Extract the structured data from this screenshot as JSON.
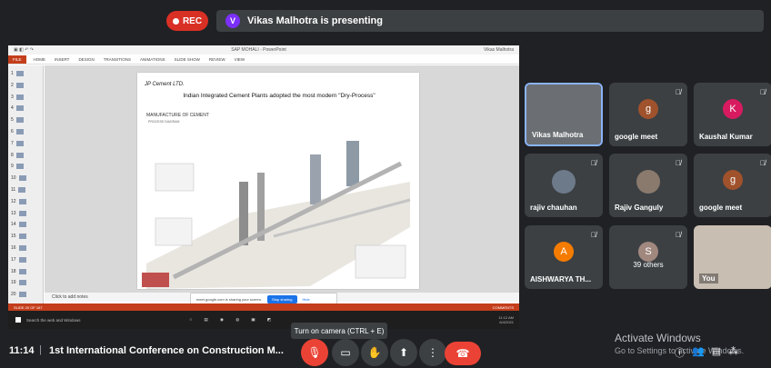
{
  "top": {
    "rec_label": "REC",
    "presenter_initial": "V",
    "presenting_text": "Vikas Malhotra is presenting"
  },
  "presentation": {
    "window_title": "SAP MOHALI - PowerPoint",
    "window_user": "Vikas Malhotra",
    "ribbon_tabs": [
      "FILE",
      "HOME",
      "INSERT",
      "DESIGN",
      "TRANSITIONS",
      "ANIMATIONS",
      "SLIDE SHOW",
      "REVIEW",
      "VIEW"
    ],
    "slide_numbers": [
      "1",
      "2",
      "3",
      "4",
      "5",
      "6",
      "7",
      "8",
      "9",
      "10",
      "11",
      "12",
      "13",
      "14",
      "15",
      "16",
      "17",
      "18",
      "19",
      "20"
    ],
    "slide": {
      "logo": "JP Cement LTD.",
      "heading": "Indian Integrated Cement Plants adopted the most modern \"Dry-Process\"",
      "section_title": "MANUFACTURE OF CEMENT",
      "section_sub": "PROCESS DIAGRAM"
    },
    "notes_placeholder": "Click to add notes",
    "share_banner": {
      "text": "meet.google.com is sharing your screen.",
      "stop_label": "Stop sharing",
      "hide_label": "Hide"
    },
    "status_left": "SLIDE 20 OF 167",
    "status_right": "COMMENTS",
    "taskbar_search": "Search the web and Windows",
    "taskbar_time": "11:12 AM",
    "taskbar_date": "6/4/2021"
  },
  "participants": [
    {
      "name": "Vikas Malhotra",
      "initial": "",
      "color": "#5f6368"
    },
    {
      "name": "google meet",
      "initial": "g",
      "color": "#a0522d"
    },
    {
      "name": "Kaushal Kumar",
      "initial": "K",
      "color": "#d81b60"
    },
    {
      "name": "rajiv chauhan",
      "initial": "",
      "color": "#6d7a8a"
    },
    {
      "name": "Rajiv Ganguly",
      "initial": "",
      "color": "#8a7a6d"
    },
    {
      "name": "google meet",
      "initial": "g",
      "color": "#a0522d"
    },
    {
      "name": "AISHWARYA TH...",
      "initial": "A",
      "color": "#f57c00"
    },
    {
      "name": "39 others",
      "initial": "S",
      "color": "#a1887f"
    },
    {
      "name": "You",
      "initial": "",
      "color": "#b8b0a6"
    }
  ],
  "bottom": {
    "time": "11:14",
    "separator": "|",
    "meeting_title": "1st International Conference on Construction M...",
    "tooltip": "Turn on camera (CTRL + E)",
    "activate_title": "Activate Windows",
    "activate_sub": "Go to Settings to activate Windows."
  },
  "colors": {
    "background": "#202124",
    "tile": "#3c4043",
    "danger": "#ea4335",
    "accent": "#1a73e8"
  },
  "icons": {
    "mic_off": "mic-off-icon",
    "camera": "camera-icon",
    "raise_hand": "hand-icon",
    "present": "present-icon",
    "more": "more-icon",
    "leave": "phone-icon"
  }
}
